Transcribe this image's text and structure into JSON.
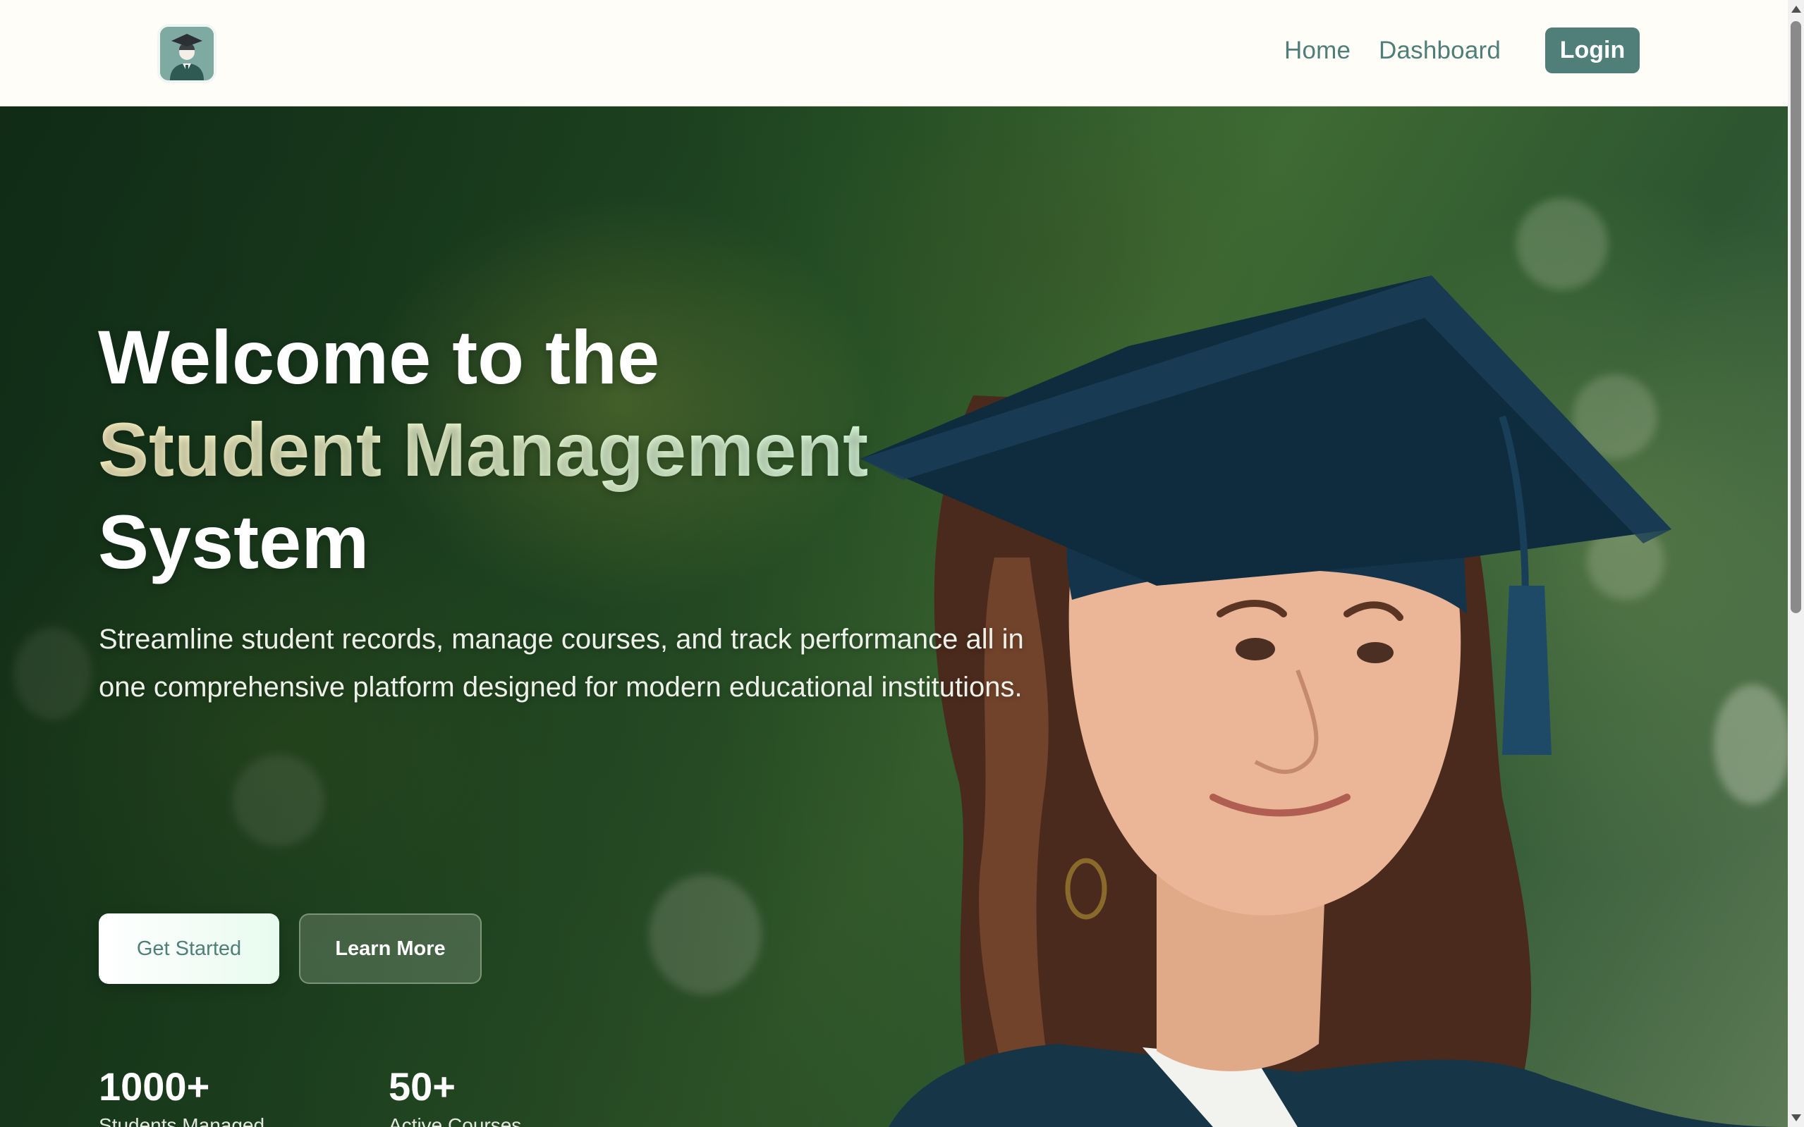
{
  "nav": {
    "logo_icon": "graduate-avatar-icon",
    "links": [
      {
        "label": "Home"
      },
      {
        "label": "Dashboard"
      }
    ],
    "login_label": "Login"
  },
  "hero": {
    "title_line1": "Welcome to the",
    "title_line2": "Student Management",
    "title_line3": "System",
    "description": "Streamline student records, manage courses, and track performance all in one comprehensive platform designed for modern educational institutions.",
    "primary_button": "Get Started",
    "secondary_button": "Learn More",
    "stats": [
      {
        "value": "1000+",
        "label": "Students Managed"
      },
      {
        "value": "50+",
        "label": "Active Courses"
      }
    ]
  },
  "colors": {
    "brand": "#4f7f78",
    "nav_background": "#fffdf7",
    "accent_text": "#fff6c6"
  }
}
